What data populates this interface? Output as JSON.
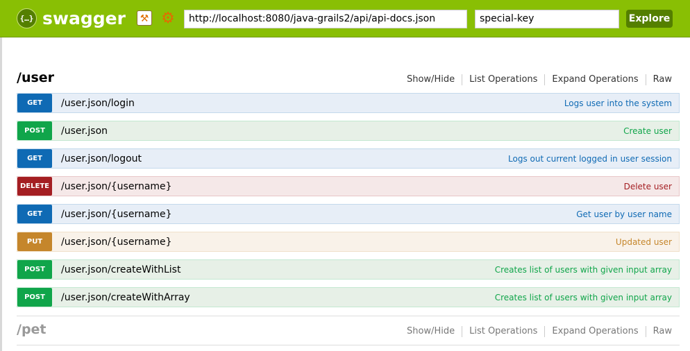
{
  "header": {
    "brand": "swagger",
    "logo_glyph": "{…}",
    "url_value": "http://localhost:8080/java-grails2/api/api-docs.json",
    "api_key_value": "special-key",
    "explore_label": "Explore",
    "colors": {
      "bar": "#89bf04",
      "button": "#547f00"
    }
  },
  "resources": [
    {
      "title": "/user",
      "links": [
        "Show/Hide",
        "List Operations",
        "Expand Operations",
        "Raw"
      ],
      "operations": [
        {
          "method": "GET",
          "path": "/user.json/login",
          "summary": "Logs user into the system"
        },
        {
          "method": "POST",
          "path": "/user.json",
          "summary": "Create user"
        },
        {
          "method": "GET",
          "path": "/user.json/logout",
          "summary": "Logs out current logged in user session"
        },
        {
          "method": "DELETE",
          "path": "/user.json/{username}",
          "summary": "Delete user"
        },
        {
          "method": "GET",
          "path": "/user.json/{username}",
          "summary": "Get user by user name"
        },
        {
          "method": "PUT",
          "path": "/user.json/{username}",
          "summary": "Updated user"
        },
        {
          "method": "POST",
          "path": "/user.json/createWithList",
          "summary": "Creates list of users with given input array"
        },
        {
          "method": "POST",
          "path": "/user.json/createWithArray",
          "summary": "Creates list of users with given input array"
        }
      ]
    },
    {
      "title": "/pet",
      "links": [
        "Show/Hide",
        "List Operations",
        "Expand Operations",
        "Raw"
      ]
    }
  ],
  "method_colors": {
    "GET": "#0f6ab4",
    "POST": "#10a54a",
    "DELETE": "#a41e22",
    "PUT": "#c5862b"
  }
}
